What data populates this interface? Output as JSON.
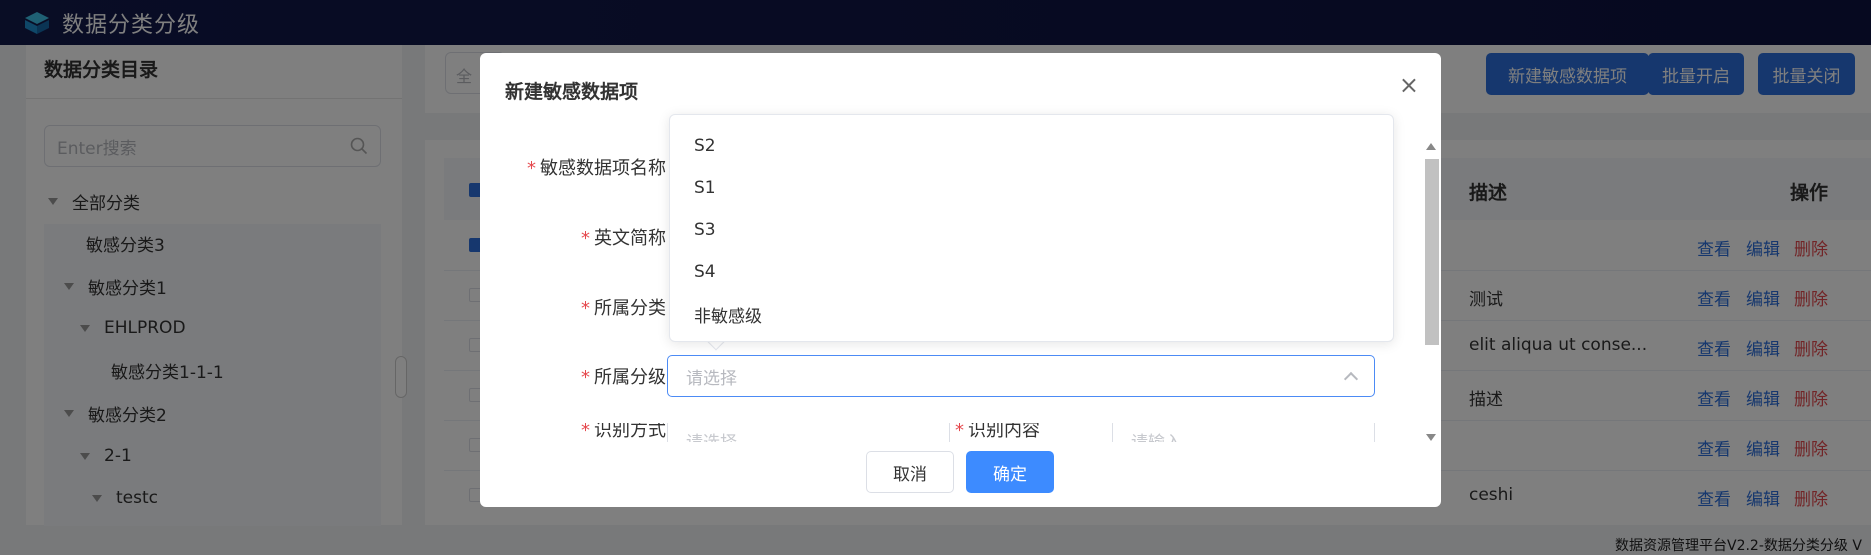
{
  "app": {
    "title": "数据分类分级"
  },
  "sidebar": {
    "title": "数据分类目录",
    "search_placeholder": "Enter搜索",
    "tree": [
      {
        "label": "全部分类",
        "level": 0,
        "expanded": true
      },
      {
        "label": "敏感分类3",
        "level": 1,
        "expanded": false
      },
      {
        "label": "敏感分类1",
        "level": 1,
        "expanded": true
      },
      {
        "label": "EHLPROD",
        "level": 2,
        "expanded": true
      },
      {
        "label": "敏感分类1-1-1",
        "level": 3,
        "expanded": false
      },
      {
        "label": "敏感分类2",
        "level": 1,
        "expanded": true
      },
      {
        "label": "2-1",
        "level": 2,
        "expanded": true
      },
      {
        "label": "testc",
        "level": 3,
        "expanded": true
      }
    ]
  },
  "toolbar": {
    "filter_text": "全",
    "new_button": "新建敏感数据项",
    "batch_open_button": "批量开启",
    "batch_close_button": "批量关闭"
  },
  "table": {
    "headers": {
      "desc": "描述",
      "ops": "操作"
    },
    "rows": [
      {
        "desc": "",
        "view": "查看",
        "edit": "编辑",
        "delete": "删除",
        "checked": true
      },
      {
        "desc": "测试",
        "view": "查看",
        "edit": "编辑",
        "delete": "删除",
        "checked": false
      },
      {
        "desc": "elit aliqua ut conse...",
        "view": "查看",
        "edit": "编辑",
        "delete": "删除",
        "checked": false
      },
      {
        "desc": "描述",
        "view": "查看",
        "edit": "编辑",
        "delete": "删除",
        "checked": false
      },
      {
        "desc": "",
        "view": "查看",
        "edit": "编辑",
        "delete": "删除",
        "checked": false
      },
      {
        "desc": "ceshi",
        "view": "查看",
        "edit": "编辑",
        "delete": "删除",
        "checked": false
      }
    ]
  },
  "footer": {
    "text": "数据资源管理平台V2.2-数据分类分级 V"
  },
  "dialog": {
    "title": "新建敏感数据项",
    "fields": {
      "name_label": "敏感数据项名称",
      "en_label": "英文简称",
      "category_label": "所属分类",
      "level_label": "所属分级",
      "level_placeholder": "请选择",
      "identify_method_label": "识别方式",
      "identify_method_placeholder": "请选择",
      "identify_content_label": "识别内容",
      "identify_content_placeholder": "请输入"
    },
    "cancel_button": "取消",
    "ok_button": "确定",
    "level_options": [
      "S2",
      "S1",
      "S3",
      "S4",
      "非敏感级"
    ]
  },
  "colors": {
    "topbar": "#121a4b",
    "primary": "#2c6fdc",
    "danger": "#e5484d"
  }
}
